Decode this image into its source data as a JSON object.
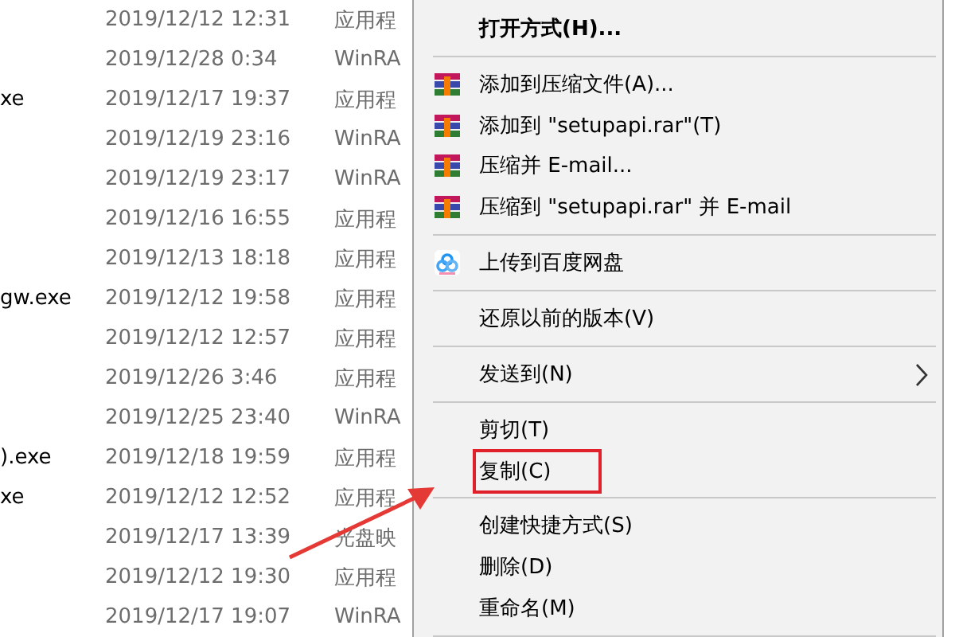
{
  "files": [
    {
      "modified": "2019/12/12 12:31",
      "type": "应用程"
    },
    {
      "modified": "2019/12/28 0:34",
      "type": "WinRA"
    },
    {
      "name": "xe",
      "modified": "2019/12/17 19:37",
      "type": "应用程"
    },
    {
      "modified": "2019/12/19 23:16",
      "type": "WinRA"
    },
    {
      "modified": "2019/12/19 23:17",
      "type": "WinRA"
    },
    {
      "modified": "2019/12/16 16:55",
      "type": "应用程"
    },
    {
      "modified": "2019/12/13 18:18",
      "type": "应用程"
    },
    {
      "name": "gw.exe",
      "modified": "2019/12/12 19:58",
      "type": "应用程"
    },
    {
      "modified": "2019/12/12 12:57",
      "type": "应用程"
    },
    {
      "modified": "2019/12/26 3:46",
      "type": "应用程"
    },
    {
      "modified": "2019/12/25 23:40",
      "type": "WinRA"
    },
    {
      "name": ").exe",
      "modified": "2019/12/18 19:59",
      "type": "应用程"
    },
    {
      "name": "xe",
      "modified": "2019/12/12 12:52",
      "type": "应用程"
    },
    {
      "modified": "2019/12/17 13:39",
      "type": "光盘映"
    },
    {
      "modified": "2019/12/12 19:30",
      "type": "应用程"
    },
    {
      "modified": "2019/12/17 19:07",
      "type": "WinRA"
    }
  ],
  "context_menu": {
    "groups": [
      [
        {
          "label": "打开方式(H)...",
          "kind": "default",
          "marked": false
        }
      ],
      [
        {
          "label": "添加到压缩文件(A)...",
          "kind": "winrar",
          "marked": false
        },
        {
          "label": "添加到 \"setupapi.rar\"(T)",
          "kind": "winrar",
          "marked": false
        },
        {
          "label": "压缩并 E-mail...",
          "kind": "winrar",
          "marked": false
        },
        {
          "label": "压缩到 \"setupapi.rar\" 并 E-mail",
          "kind": "winrar",
          "marked": false
        }
      ],
      [
        {
          "label": "上传到百度网盘",
          "kind": "cloud",
          "marked": false
        }
      ],
      [
        {
          "label": "还原以前的版本(V)",
          "kind": "plain",
          "marked": false
        }
      ],
      [
        {
          "label": "发送到(N)",
          "kind": "submenu",
          "marked": false
        }
      ],
      [
        {
          "label": "剪切(T)",
          "kind": "plain",
          "marked": false
        },
        {
          "label": "复制(C)",
          "kind": "plain",
          "marked": true
        }
      ],
      [
        {
          "label": "创建快捷方式(S)",
          "kind": "plain",
          "marked": false
        },
        {
          "label": "删除(D)",
          "kind": "plain",
          "marked": false
        },
        {
          "label": "重命名(M)",
          "kind": "plain",
          "marked": false
        }
      ]
    ]
  }
}
